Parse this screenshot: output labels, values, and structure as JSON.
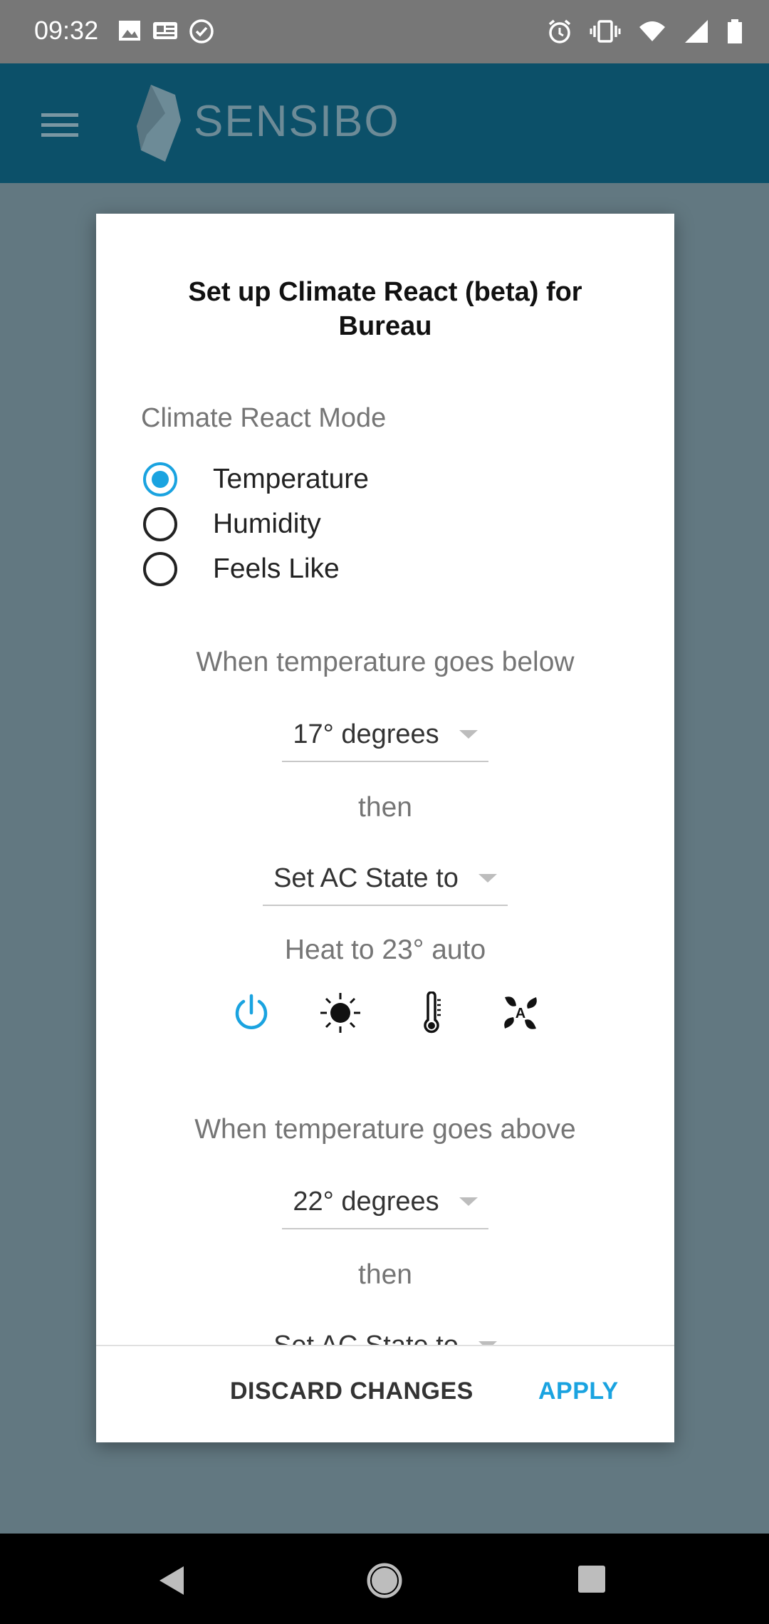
{
  "status_bar": {
    "time": "09:32",
    "left_icons": [
      "image-icon",
      "news-icon",
      "check-circle-icon"
    ],
    "right_icons": [
      "alarm-icon",
      "vibrate-icon",
      "wifi-icon",
      "signal-icon",
      "battery-icon"
    ]
  },
  "app_bar": {
    "brand": "SENSIBO",
    "menu_icon": "hamburger-menu-icon",
    "background": "#0c5069"
  },
  "dialog": {
    "title": "Set up Climate React (beta) for Bureau",
    "mode_label": "Climate React Mode",
    "modes": [
      {
        "label": "Temperature",
        "selected": true
      },
      {
        "label": "Humidity",
        "selected": false
      },
      {
        "label": "Feels Like",
        "selected": false
      }
    ],
    "below": {
      "condition": "When temperature goes below",
      "threshold": "17° degrees",
      "then": "then",
      "action": "Set AC State to",
      "state_summary": "Heat to 23° auto",
      "icons": [
        "power-icon",
        "sun-icon",
        "thermometer-icon",
        "fan-auto-icon"
      ]
    },
    "above": {
      "condition": "When temperature goes above",
      "threshold": "22° degrees",
      "then": "then",
      "action": "Set AC State to"
    },
    "buttons": {
      "discard": "DISCARD CHANGES",
      "apply": "APPLY"
    }
  },
  "colors": {
    "accent": "#1aa3e0",
    "app_bar": "#0c5069"
  }
}
